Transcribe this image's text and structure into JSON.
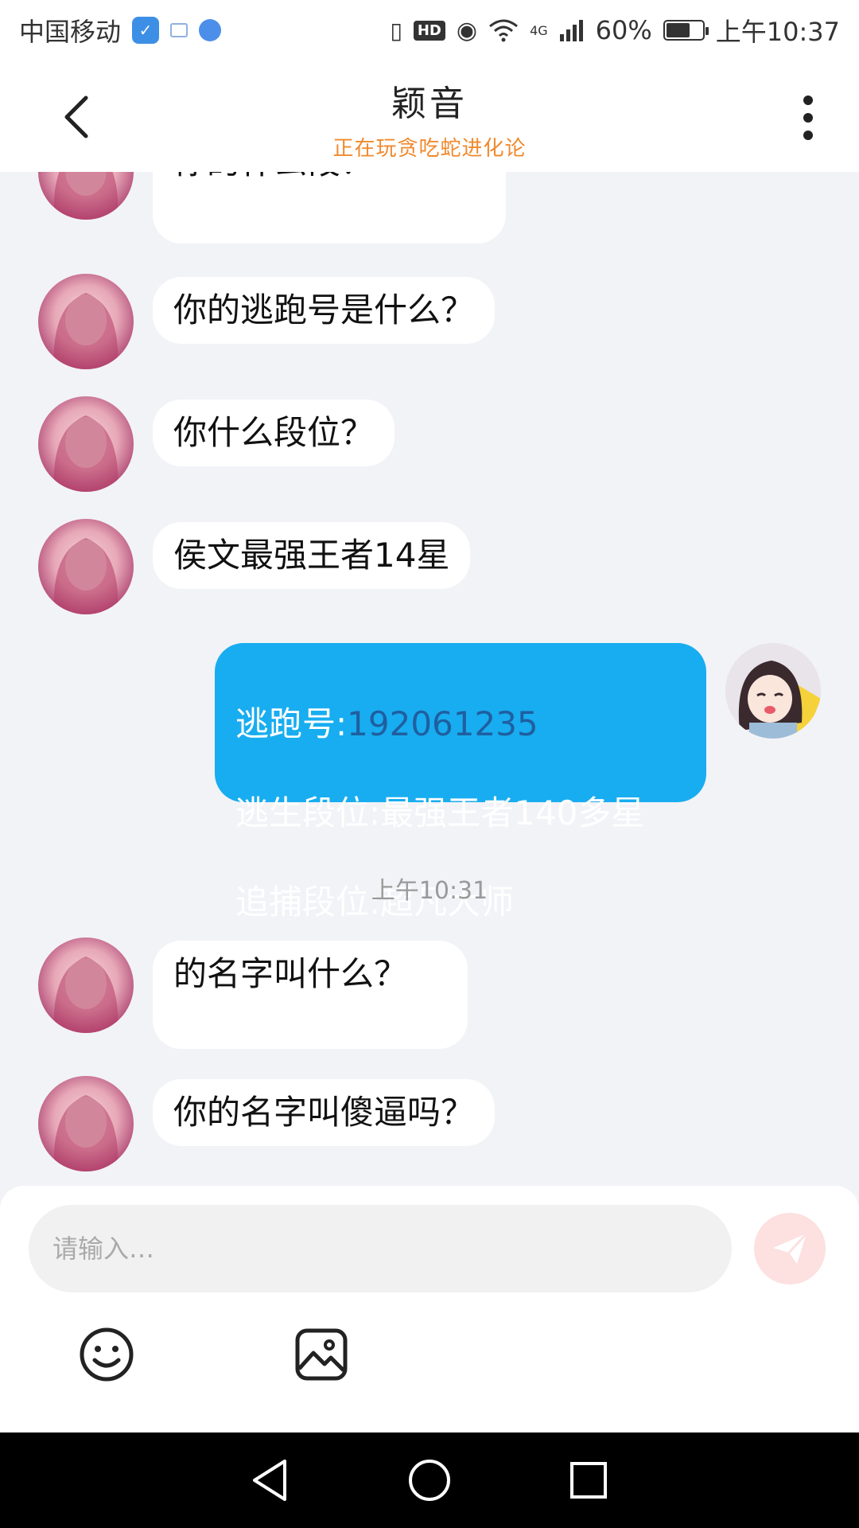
{
  "status_bar": {
    "carrier": "中国移动",
    "network": "4G",
    "battery": "60%",
    "time": "上午10:37",
    "hd_badge": "HD"
  },
  "header": {
    "title": "颖音",
    "subtitle": "正在玩贪吃蛇进化论"
  },
  "messages": [
    {
      "side": "in",
      "text": "你的什么段？"
    },
    {
      "side": "in",
      "text": "你的逃跑号是什么？"
    },
    {
      "side": "in",
      "text": "你什么段位？"
    },
    {
      "side": "in",
      "text": "侯文最强王者14星"
    },
    {
      "side": "out",
      "lines": [
        {
          "label": "逃跑号:",
          "value": "192061235"
        },
        {
          "label": "逃生段位:",
          "value": "最强王者140多星"
        },
        {
          "label": "追捕段位:",
          "value": "超凡大师"
        }
      ]
    },
    {
      "side": "time",
      "text": "上午10:31"
    },
    {
      "side": "in",
      "text": "的名字叫什么？"
    },
    {
      "side": "in",
      "text": "你的名字叫傻逼吗？"
    }
  ],
  "composer": {
    "placeholder": "请输入…",
    "value": ""
  },
  "colors": {
    "accent_blue": "#18adf0",
    "subtitle_orange": "#f08a2e",
    "send_bg": "#fde0e0"
  },
  "icons": {
    "back": "chevron-left-icon",
    "more": "more-vertical-icon",
    "send": "paper-plane-icon",
    "emoji": "smiley-icon",
    "image": "image-icon"
  }
}
